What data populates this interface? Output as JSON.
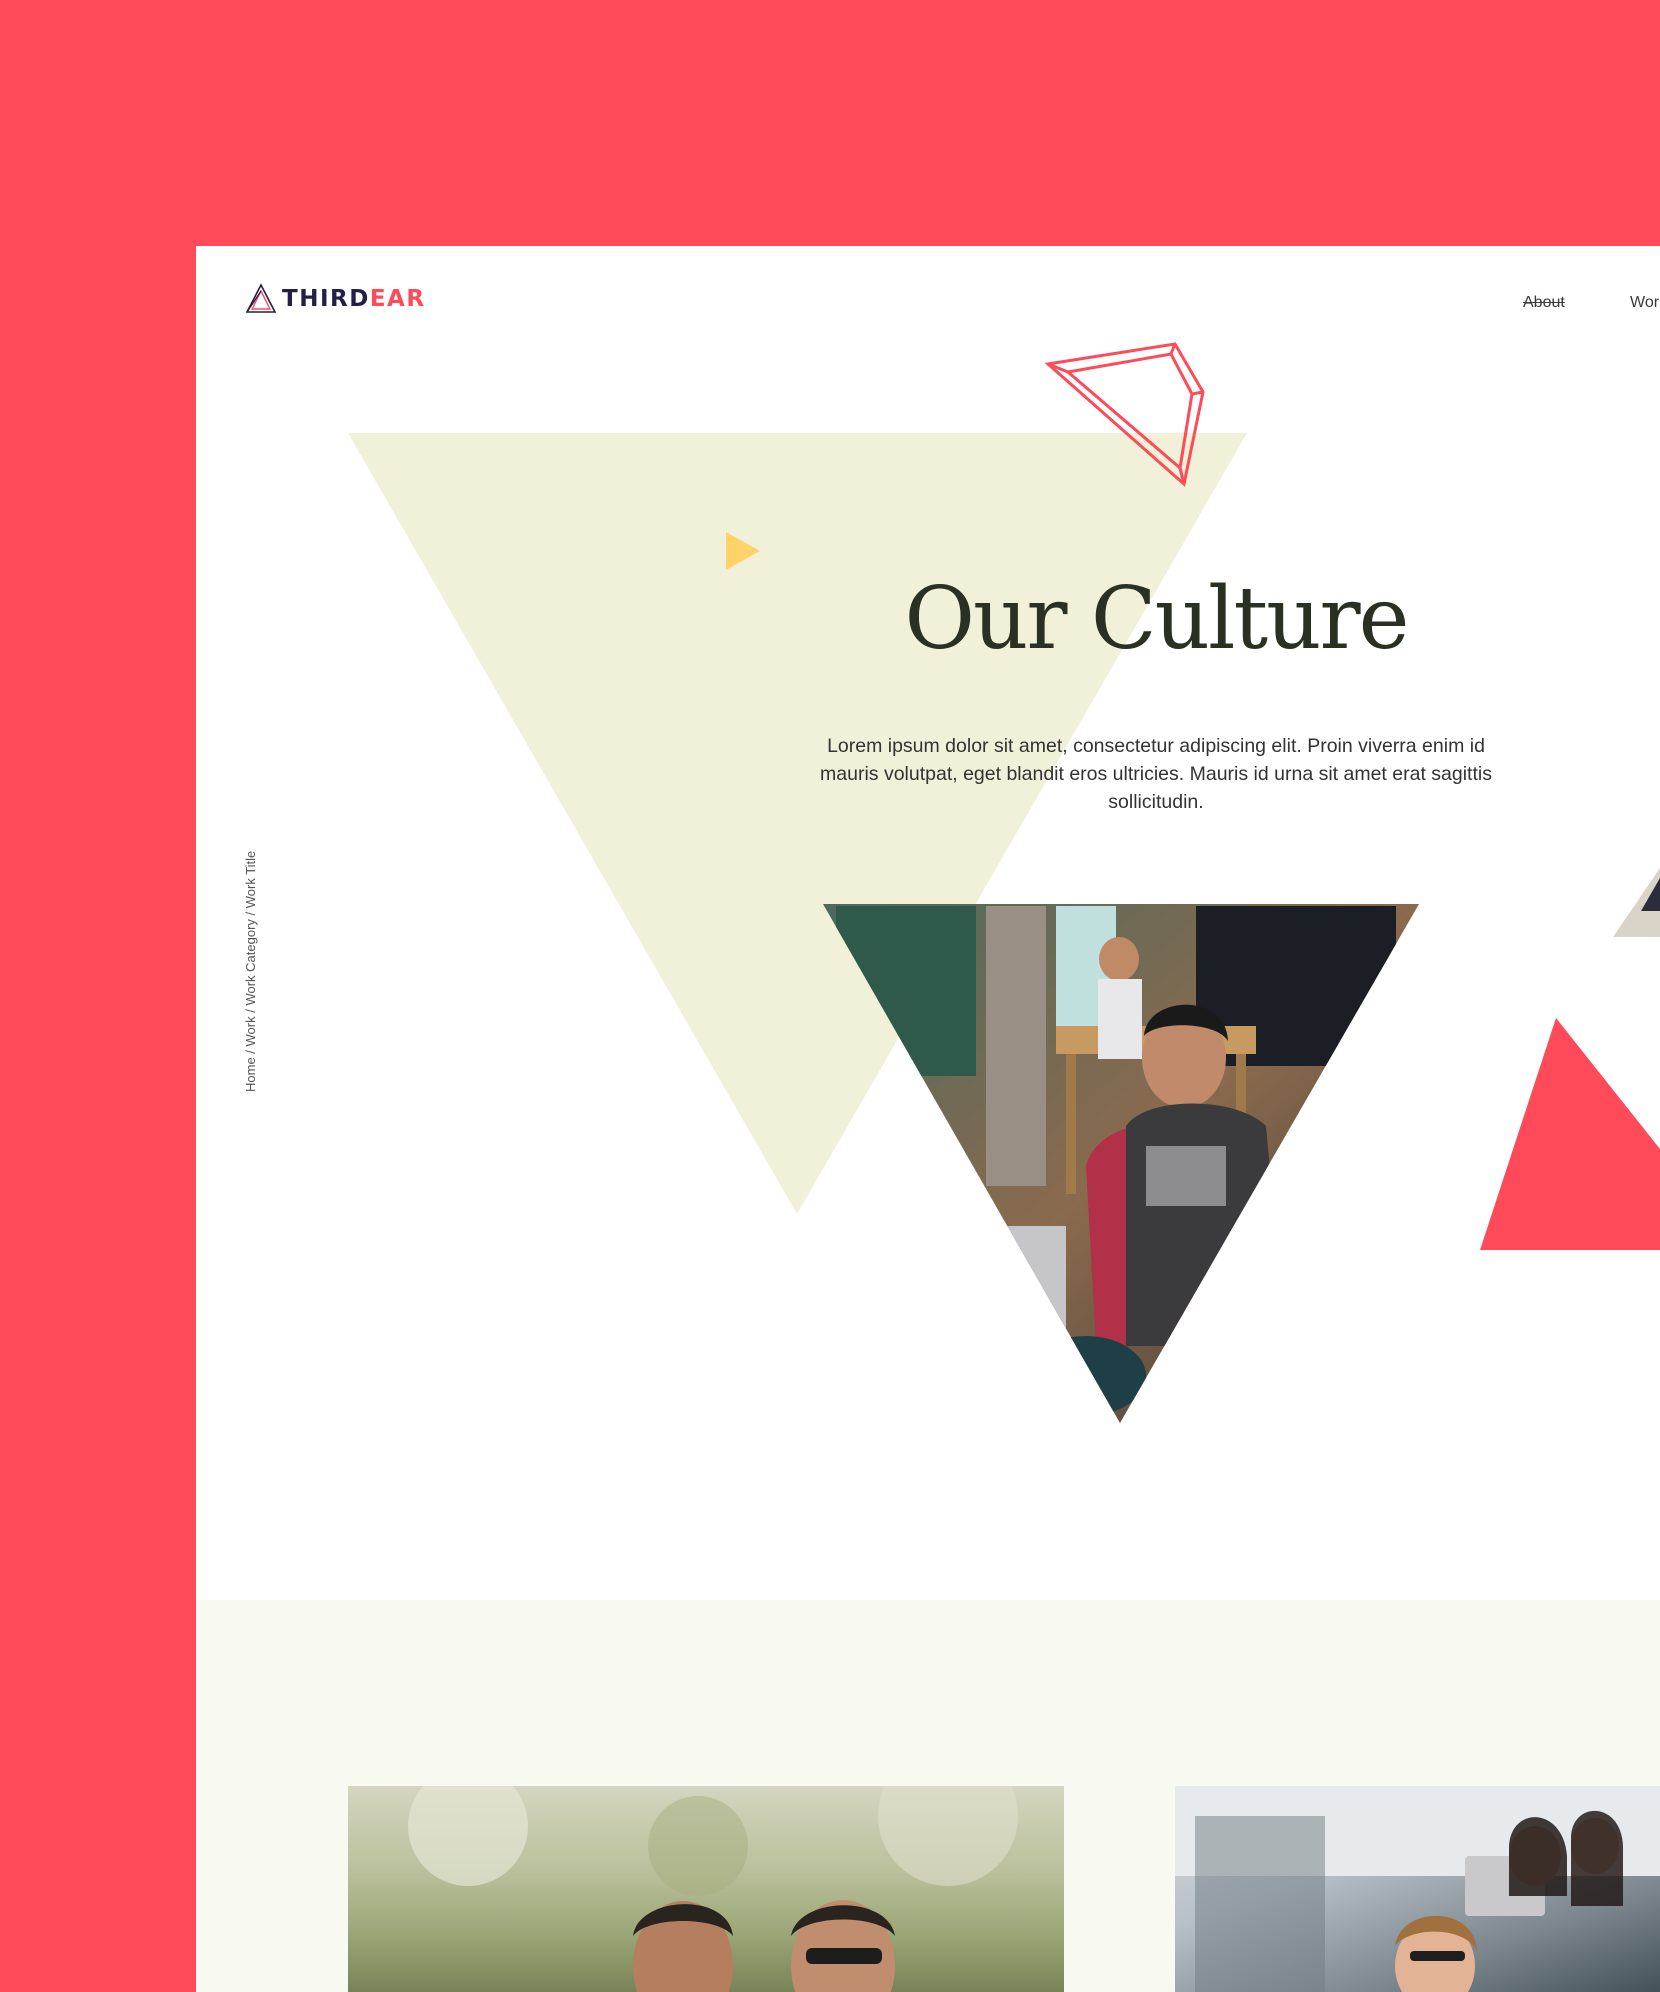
{
  "colors": {
    "accent": "#ff4a5a",
    "sage": "#f1f1da",
    "yellow": "#ffd36a",
    "dark": "#2a3122",
    "navy": "#231f4a"
  },
  "logo": {
    "part1": "THIRD",
    "part2": "EAR"
  },
  "nav": {
    "items": [
      "About",
      "Wor"
    ]
  },
  "breadcrumb": "Home / Work / Work Category / Work Title",
  "hero": {
    "title": "Our Culture",
    "text": "Lorem ipsum dolor sit amet, consectetur adipiscing elit. Proin viverra enim id mauris volutpat, eget blandit eros ultricies. Mauris id urna sit amet erat sagittis sollicitudin."
  },
  "icons": {
    "logo": "triangle-logo-icon",
    "play": "play-triangle-icon"
  }
}
